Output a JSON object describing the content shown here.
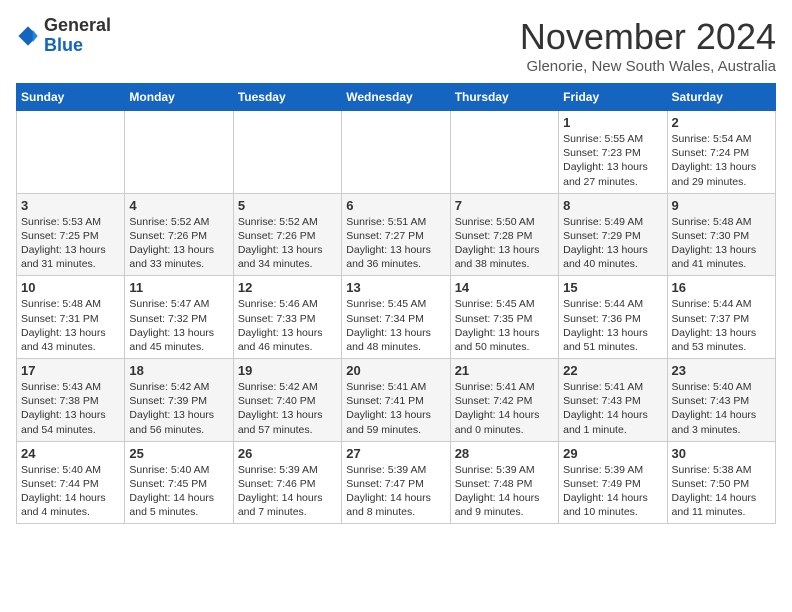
{
  "header": {
    "logo_general": "General",
    "logo_blue": "Blue",
    "month_title": "November 2024",
    "subtitle": "Glenorie, New South Wales, Australia"
  },
  "weekdays": [
    "Sunday",
    "Monday",
    "Tuesday",
    "Wednesday",
    "Thursday",
    "Friday",
    "Saturday"
  ],
  "weeks": [
    [
      {
        "day": "",
        "info": ""
      },
      {
        "day": "",
        "info": ""
      },
      {
        "day": "",
        "info": ""
      },
      {
        "day": "",
        "info": ""
      },
      {
        "day": "",
        "info": ""
      },
      {
        "day": "1",
        "info": "Sunrise: 5:55 AM\nSunset: 7:23 PM\nDaylight: 13 hours\nand 27 minutes."
      },
      {
        "day": "2",
        "info": "Sunrise: 5:54 AM\nSunset: 7:24 PM\nDaylight: 13 hours\nand 29 minutes."
      }
    ],
    [
      {
        "day": "3",
        "info": "Sunrise: 5:53 AM\nSunset: 7:25 PM\nDaylight: 13 hours\nand 31 minutes."
      },
      {
        "day": "4",
        "info": "Sunrise: 5:52 AM\nSunset: 7:26 PM\nDaylight: 13 hours\nand 33 minutes."
      },
      {
        "day": "5",
        "info": "Sunrise: 5:52 AM\nSunset: 7:26 PM\nDaylight: 13 hours\nand 34 minutes."
      },
      {
        "day": "6",
        "info": "Sunrise: 5:51 AM\nSunset: 7:27 PM\nDaylight: 13 hours\nand 36 minutes."
      },
      {
        "day": "7",
        "info": "Sunrise: 5:50 AM\nSunset: 7:28 PM\nDaylight: 13 hours\nand 38 minutes."
      },
      {
        "day": "8",
        "info": "Sunrise: 5:49 AM\nSunset: 7:29 PM\nDaylight: 13 hours\nand 40 minutes."
      },
      {
        "day": "9",
        "info": "Sunrise: 5:48 AM\nSunset: 7:30 PM\nDaylight: 13 hours\nand 41 minutes."
      }
    ],
    [
      {
        "day": "10",
        "info": "Sunrise: 5:48 AM\nSunset: 7:31 PM\nDaylight: 13 hours\nand 43 minutes."
      },
      {
        "day": "11",
        "info": "Sunrise: 5:47 AM\nSunset: 7:32 PM\nDaylight: 13 hours\nand 45 minutes."
      },
      {
        "day": "12",
        "info": "Sunrise: 5:46 AM\nSunset: 7:33 PM\nDaylight: 13 hours\nand 46 minutes."
      },
      {
        "day": "13",
        "info": "Sunrise: 5:45 AM\nSunset: 7:34 PM\nDaylight: 13 hours\nand 48 minutes."
      },
      {
        "day": "14",
        "info": "Sunrise: 5:45 AM\nSunset: 7:35 PM\nDaylight: 13 hours\nand 50 minutes."
      },
      {
        "day": "15",
        "info": "Sunrise: 5:44 AM\nSunset: 7:36 PM\nDaylight: 13 hours\nand 51 minutes."
      },
      {
        "day": "16",
        "info": "Sunrise: 5:44 AM\nSunset: 7:37 PM\nDaylight: 13 hours\nand 53 minutes."
      }
    ],
    [
      {
        "day": "17",
        "info": "Sunrise: 5:43 AM\nSunset: 7:38 PM\nDaylight: 13 hours\nand 54 minutes."
      },
      {
        "day": "18",
        "info": "Sunrise: 5:42 AM\nSunset: 7:39 PM\nDaylight: 13 hours\nand 56 minutes."
      },
      {
        "day": "19",
        "info": "Sunrise: 5:42 AM\nSunset: 7:40 PM\nDaylight: 13 hours\nand 57 minutes."
      },
      {
        "day": "20",
        "info": "Sunrise: 5:41 AM\nSunset: 7:41 PM\nDaylight: 13 hours\nand 59 minutes."
      },
      {
        "day": "21",
        "info": "Sunrise: 5:41 AM\nSunset: 7:42 PM\nDaylight: 14 hours\nand 0 minutes."
      },
      {
        "day": "22",
        "info": "Sunrise: 5:41 AM\nSunset: 7:43 PM\nDaylight: 14 hours\nand 1 minute."
      },
      {
        "day": "23",
        "info": "Sunrise: 5:40 AM\nSunset: 7:43 PM\nDaylight: 14 hours\nand 3 minutes."
      }
    ],
    [
      {
        "day": "24",
        "info": "Sunrise: 5:40 AM\nSunset: 7:44 PM\nDaylight: 14 hours\nand 4 minutes."
      },
      {
        "day": "25",
        "info": "Sunrise: 5:40 AM\nSunset: 7:45 PM\nDaylight: 14 hours\nand 5 minutes."
      },
      {
        "day": "26",
        "info": "Sunrise: 5:39 AM\nSunset: 7:46 PM\nDaylight: 14 hours\nand 7 minutes."
      },
      {
        "day": "27",
        "info": "Sunrise: 5:39 AM\nSunset: 7:47 PM\nDaylight: 14 hours\nand 8 minutes."
      },
      {
        "day": "28",
        "info": "Sunrise: 5:39 AM\nSunset: 7:48 PM\nDaylight: 14 hours\nand 9 minutes."
      },
      {
        "day": "29",
        "info": "Sunrise: 5:39 AM\nSunset: 7:49 PM\nDaylight: 14 hours\nand 10 minutes."
      },
      {
        "day": "30",
        "info": "Sunrise: 5:38 AM\nSunset: 7:50 PM\nDaylight: 14 hours\nand 11 minutes."
      }
    ]
  ]
}
